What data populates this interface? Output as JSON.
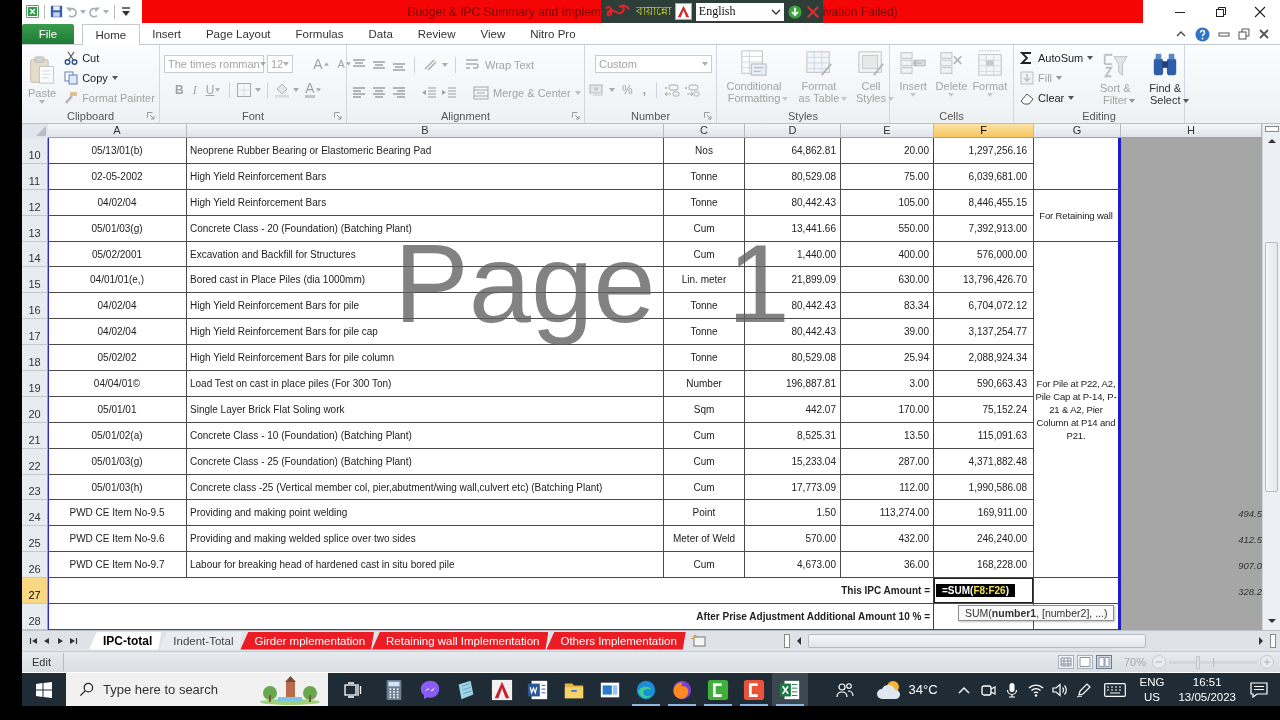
{
  "window": {
    "title_parts": [
      "Budget & IPC Summary and Implem",
      "ivation Failed)"
    ]
  },
  "keyboard_toolbar": {
    "layout_name": "বায়ান্নো",
    "language": "English"
  },
  "ribbon_tabs": [
    {
      "label": "File",
      "kind": "file",
      "selected": false
    },
    {
      "label": "Home",
      "kind": "tab",
      "selected": true
    },
    {
      "label": "Insert",
      "kind": "tab",
      "selected": false
    },
    {
      "label": "Page Layout",
      "kind": "tab",
      "selected": false
    },
    {
      "label": "Formulas",
      "kind": "tab",
      "selected": false
    },
    {
      "label": "Data",
      "kind": "tab",
      "selected": false
    },
    {
      "label": "Review",
      "kind": "tab",
      "selected": false
    },
    {
      "label": "View",
      "kind": "tab",
      "selected": false
    },
    {
      "label": "Nitro Pro",
      "kind": "tab",
      "selected": false
    }
  ],
  "ribbon": {
    "clipboard": {
      "label": "Clipboard",
      "paste": {
        "label": "Paste",
        "disabled": true
      },
      "cut": {
        "label": "Cut",
        "disabled": false
      },
      "copy": {
        "label": "Copy",
        "disabled": false
      },
      "format_painter": {
        "label": "Format Painter",
        "disabled": true
      }
    },
    "font": {
      "label": "Font",
      "disabled": true,
      "name": "The times romman",
      "size": "12",
      "grow": "A",
      "shrink": "A",
      "bold": "B",
      "italic": "I",
      "underline": "U",
      "font_color": "A"
    },
    "alignment": {
      "label": "Alignment",
      "disabled": true,
      "wrap_text": "Wrap Text",
      "merge": "Merge & Center"
    },
    "number": {
      "label": "Number",
      "disabled": true,
      "format": "Custom",
      "percent": "%",
      "comma": ","
    },
    "styles": {
      "label": "Styles",
      "buttons": [
        {
          "label": "Conditional Formatting",
          "kind": "conditional",
          "disabled": true
        },
        {
          "label": "Format as Table",
          "kind": "table",
          "disabled": true
        },
        {
          "label": "Cell Styles",
          "kind": "styles",
          "disabled": true
        }
      ]
    },
    "cells": {
      "label": "Cells",
      "buttons": [
        {
          "label": "Insert",
          "kind": "insert",
          "disabled": true
        },
        {
          "label": "Delete",
          "kind": "delete",
          "disabled": true
        },
        {
          "label": "Format",
          "kind": "format",
          "disabled": true
        }
      ]
    },
    "editing": {
      "label": "Editing",
      "small": [
        {
          "label": "AutoSum",
          "kind": "autosum",
          "disabled": false
        },
        {
          "label": "Fill",
          "kind": "fill",
          "disabled": true
        },
        {
          "label": "Clear",
          "kind": "clear",
          "disabled": false
        }
      ],
      "big": [
        {
          "label": "Sort & Filter",
          "kind": "sort",
          "disabled": true
        },
        {
          "label": "Find & Select",
          "kind": "find",
          "disabled": false
        }
      ]
    }
  },
  "sheet": {
    "columns": [
      {
        "label": "A",
        "selected": false
      },
      {
        "label": "B",
        "selected": false
      },
      {
        "label": "C",
        "selected": false
      },
      {
        "label": "D",
        "selected": false
      },
      {
        "label": "E",
        "selected": false
      },
      {
        "label": "F",
        "selected": true
      },
      {
        "label": "G",
        "selected": false
      },
      {
        "label": "H",
        "selected": false
      }
    ],
    "row_groups": [
      {
        "rows": [
          {
            "number": "10",
            "selected": false,
            "cells": [
              "05/13/01(b)",
              "Neoprene Rubber Bearing or Elastomeric Bearing Pad",
              "Nos",
              "64,862.81",
              "20.00",
              "1,297,256.16"
            ]
          },
          {
            "number": "11",
            "selected": false,
            "cells": [
              "02-05-2002",
              "High Yield Reinforcement Bars",
              "Tonne",
              "80,529.08",
              "75.00",
              "6,039,681.00"
            ]
          }
        ]
      },
      {
        "note": "For Retaining wall",
        "rows": [
          {
            "number": "12",
            "selected": false,
            "cells": [
              "04/02/04",
              "High Yield Reinforcement Bars",
              "Tonne",
              "80,442.43",
              "105.00",
              "8,446,455.15"
            ]
          },
          {
            "number": "13",
            "selected": false,
            "cells": [
              "05/01/03(g)",
              "Concrete Class - 20 (Foundation) (Batching Plant)",
              "Cum",
              "13,441.66",
              "550.00",
              "7,392,913.00"
            ]
          }
        ]
      },
      {
        "note": "For Pile at P22, A2, Pile Cap at P-14, P-21 & A2, Pier Column at P14 and P21.",
        "rows": [
          {
            "number": "14",
            "selected": false,
            "cells": [
              "05/02/2001",
              "Excavation and Backfill for Structures",
              "Cum",
              "1,440.00",
              "400.00",
              "576,000.00"
            ]
          },
          {
            "number": "15",
            "selected": false,
            "cells": [
              "04/01/01(e,)",
              "Bored cast in Place Piles (dia 1000mm)",
              "Lin. meter",
              "21,899.09",
              "630.00",
              "13,796,426.70"
            ]
          },
          {
            "number": "16",
            "selected": false,
            "cells": [
              "04/02/04",
              "High Yield Reinforcement Bars for pile",
              "Tonne",
              "80,442.43",
              "83.34",
              "6,704,072.12"
            ]
          },
          {
            "number": "17",
            "selected": false,
            "cells": [
              "04/02/04",
              "High Yield Reinforcement Bars for pile cap",
              "Tonne",
              "80,442.43",
              "39.00",
              "3,137,254.77"
            ]
          },
          {
            "number": "18",
            "selected": false,
            "cells": [
              "05/02/02",
              "High Yield Reinforcement Bars for pile column",
              "Tonne",
              "80,529.08",
              "25.94",
              "2,088,924.34"
            ]
          },
          {
            "number": "19",
            "selected": false,
            "cells": [
              "04/04/01©",
              "Load Test on cast in place piles (For 300 Ton)",
              "Number",
              "196,887.81",
              "3.00",
              "590,663.43"
            ]
          },
          {
            "number": "20",
            "selected": false,
            "cells": [
              "05/01/01",
              "Single Layer Brick Flat Soling work",
              "Sqm",
              "442.07",
              "170.00",
              "75,152.24"
            ]
          },
          {
            "number": "21",
            "selected": false,
            "cells": [
              "05/01/02(a)",
              "Concrete Class - 10 (Foundation) (Batching Plant)",
              "Cum",
              "8,525.31",
              "13.50",
              "115,091.63"
            ]
          },
          {
            "number": "22",
            "selected": false,
            "cells": [
              "05/01/03(g)",
              "Concrete Class - 25 (Foundation) (Batching Plant)",
              "Cum",
              "15,233.04",
              "287.00",
              "4,371,882.48"
            ]
          },
          {
            "number": "23",
            "selected": false,
            "cells": [
              "05/01/03(h)",
              "Concrete class -25 (Vertical member col, pier,abutment/wing wall,culvert etc) (Batching Plant)",
              "Cum",
              "17,773.09",
              "112.00",
              "1,990,586.08"
            ]
          },
          {
            "number": "24",
            "selected": false,
            "cells": [
              "PWD CE Item No-9.5",
              "Providing and making point welding",
              "Point",
              "1.50",
              "113,274.00",
              "169,911.00"
            ],
            "h": "494.5"
          },
          {
            "number": "25",
            "selected": false,
            "cells": [
              "PWD CE Item No-9.6",
              "Providing and making welded splice over two sides",
              "Meter of Weld",
              "570.00",
              "432.00",
              "246,240.00"
            ],
            "h": "412.5"
          },
          {
            "number": "26",
            "selected": false,
            "cells": [
              "PWD CE Item No-9.7",
              "Labour for breaking head of hardened cast in situ bored pile",
              "Cum",
              "4,673.00",
              "36.00",
              "168,228.00"
            ],
            "h": "907.0"
          }
        ]
      }
    ],
    "totals": [
      {
        "number": "27",
        "selected": true,
        "label": "This IPC Amount =",
        "formula": {
          "prefix": "=SUM(",
          "reference": "F8:F26",
          "suffix": ")"
        },
        "tooltip": "SUM(**number1**, [number2], ...)",
        "h": "328.2"
      },
      {
        "number": "28",
        "selected": false,
        "label": "After Prise Adjustment Additional Amount 10 % ="
      }
    ]
  },
  "page_watermark": {
    "word": "Page",
    "number": "1"
  },
  "sheet_tabs": [
    {
      "label": "IPC-total",
      "selected": true
    },
    {
      "label": "Indent-Total",
      "selected": false
    },
    {
      "label": "Girder mplementation",
      "selected": false,
      "color": "#ec1c24"
    },
    {
      "label": "Retaining wall Implementation",
      "selected": false,
      "color": "#ec1c24"
    },
    {
      "label": "Others Implementation",
      "selected": false,
      "color": "#ec1c24"
    }
  ],
  "status_bar": {
    "mode": "Edit",
    "views": [
      {
        "kind": "normal",
        "selected": false
      },
      {
        "kind": "page_layout",
        "selected": false
      },
      {
        "kind": "page_break",
        "selected": true
      }
    ],
    "zoom": "70%",
    "zoom_slider": {
      "level": 0.33
    }
  },
  "taskbar": {
    "search": {
      "placeholder": "Type here to search"
    },
    "apps": [
      {
        "kind": "calculator",
        "running": false,
        "active": false
      },
      {
        "kind": "messenger",
        "running": false,
        "active": false
      },
      {
        "kind": "notepad",
        "running": false,
        "active": false
      },
      {
        "kind": "cad",
        "running": false,
        "active": false
      },
      {
        "kind": "word",
        "running": false,
        "active": false
      },
      {
        "kind": "explorer",
        "running": false,
        "active": false
      },
      {
        "kind": "window",
        "running": false,
        "active": false
      },
      {
        "kind": "edge",
        "running": true,
        "active": false
      },
      {
        "kind": "firefox",
        "running": true,
        "active": false
      },
      {
        "kind": "recorder",
        "running": true,
        "active": false
      },
      {
        "kind": "editor",
        "running": true,
        "active": false
      },
      {
        "kind": "excel",
        "running": true,
        "active": true
      }
    ],
    "temperature": "34°C",
    "language": "ENG",
    "region": "US",
    "time": "16:51",
    "date": "13/05/2023"
  }
}
